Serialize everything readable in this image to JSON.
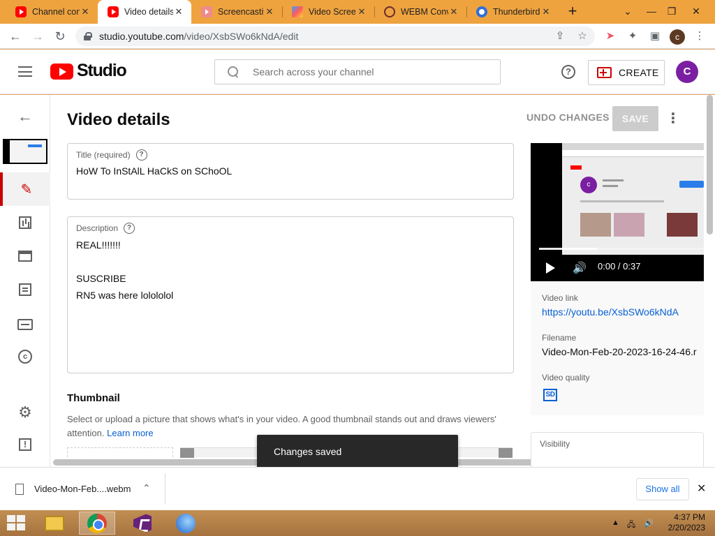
{
  "browser": {
    "tabs": [
      {
        "title": "Channel content",
        "favicon": "youtube-icon",
        "active": false
      },
      {
        "title": "Video details",
        "favicon": "youtube-icon",
        "active": true
      },
      {
        "title": "Screencastify",
        "favicon": "screencastify-icon",
        "active": false
      },
      {
        "title": "Video Screen",
        "favicon": "video-screen-icon",
        "active": false
      },
      {
        "title": "WEBM Conve",
        "favicon": "webm-converter-icon",
        "active": false
      },
      {
        "title": "Thunderbird",
        "favicon": "thunderbird-icon",
        "active": false
      }
    ],
    "new_tab_label": "+",
    "url_host": "studio.youtube.com",
    "url_path": "/video/XsbSWo6kNdA/edit",
    "profile_initial": "c"
  },
  "header": {
    "logo_text": "Studio",
    "search_placeholder": "Search across your channel",
    "create_label": "CREATE",
    "avatar_initial": "C",
    "help_glyph": "?"
  },
  "main": {
    "page_title": "Video details",
    "undo_label": "UNDO CHANGES",
    "save_label": "SAVE",
    "title_field": {
      "label": "Title (required)",
      "value": "HoW To InStAlL HaCkS on SChoOL"
    },
    "description_field": {
      "label": "Description",
      "value": "REAL!!!!!!!\n\nSUSCRIBE\nRN5 was here lolololol"
    },
    "thumbnail": {
      "title": "Thumbnail",
      "description": "Select or upload a picture that shows what's in your video. A good thumbnail stands out and draws viewers' attention.",
      "learn_more": "Learn more"
    }
  },
  "video": {
    "time": "0:00 / 0:37",
    "preview_avatar": "c",
    "progress_fraction": 0.35,
    "link_label": "Video link",
    "link_value": "https://youtu.be/XsbSWo6kNdA",
    "filename_label": "Filename",
    "filename_value": "Video-Mon-Feb-20-2023-16-24-46.r",
    "quality_label": "Video quality",
    "quality_badge": "SD",
    "visibility_label": "Visibility"
  },
  "toast": {
    "message": "Changes saved"
  },
  "downloads": {
    "file_name": "Video-Mon-Feb....webm",
    "show_all_label": "Show all"
  },
  "taskbar": {
    "apps": [
      "file-explorer-icon",
      "chrome-icon",
      "visual-studio-icon",
      "thunderbird-icon"
    ],
    "time": "4:37 PM",
    "date": "2/20/2023"
  }
}
